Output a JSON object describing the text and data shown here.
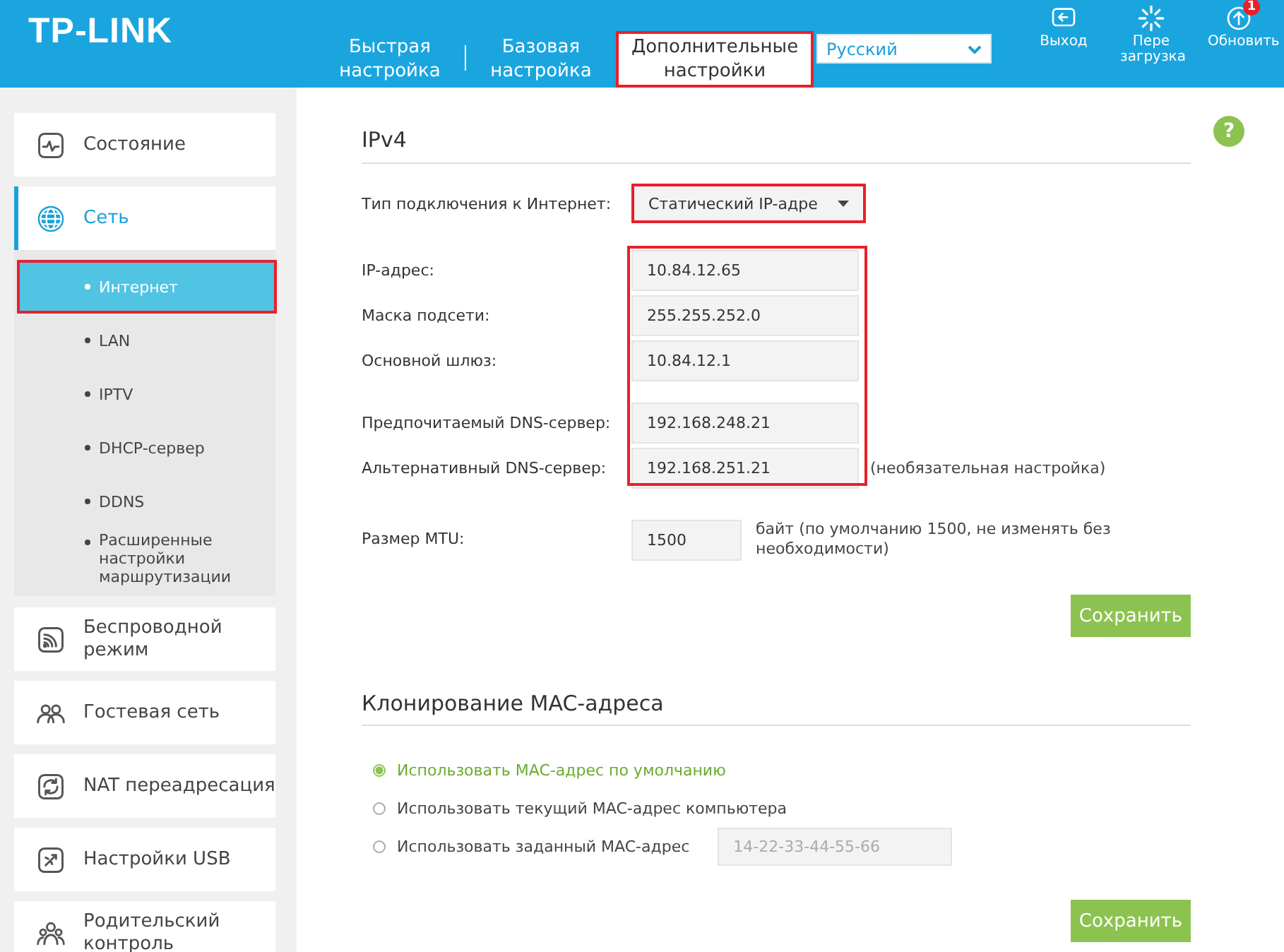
{
  "header": {
    "logo": "TP-LINK",
    "nav_tabs": [
      {
        "label": "Быстрая настройка",
        "selected": false,
        "highlighted": false
      },
      {
        "label": "Базовая настройка",
        "selected": false,
        "highlighted": false
      },
      {
        "label": "Дополнительные настройки",
        "selected": true,
        "highlighted": true
      }
    ],
    "language": {
      "value": "Русский"
    },
    "actions": [
      {
        "label": "Выход"
      },
      {
        "label": "Пере загрузка"
      },
      {
        "label": "Обновить",
        "badge": "1"
      }
    ]
  },
  "sidebar": {
    "items": [
      {
        "label": "Состояние",
        "selected": false
      },
      {
        "label": "Сеть",
        "selected": true,
        "expanded": true,
        "children": [
          {
            "label": "Интернет",
            "selected": true,
            "highlighted": true
          },
          {
            "label": "LAN",
            "selected": false,
            "highlighted": false
          },
          {
            "label": "IPTV",
            "selected": false,
            "highlighted": false
          },
          {
            "label": "DHCP-сервер",
            "selected": false,
            "highlighted": false
          },
          {
            "label": "DDNS",
            "selected": false,
            "highlighted": false
          },
          {
            "label": "Расширенные настройки маршрутизации",
            "selected": false,
            "highlighted": false
          }
        ]
      },
      {
        "label": "Беспроводной режим",
        "selected": false
      },
      {
        "label": "Гостевая сеть",
        "selected": false
      },
      {
        "label": "NAT переадресация",
        "selected": false
      },
      {
        "label": "Настройки USB",
        "selected": false
      },
      {
        "label": "Родительский контроль",
        "selected": false
      }
    ]
  },
  "help_button": {
    "label": "?"
  },
  "ipv4": {
    "title": "IPv4",
    "connection_type": {
      "label": "Тип подключения к Интернет:",
      "value": "Статический IP-адре",
      "highlighted": true
    },
    "fields_highlighted": true,
    "address_fields": [
      {
        "label": "IP-адрес:",
        "value": "10.84.12.65"
      },
      {
        "label": "Маска подсети:",
        "value": "255.255.252.0"
      },
      {
        "label": "Основной шлюз:",
        "value": "10.84.12.1"
      }
    ],
    "dns_fields": [
      {
        "label": "Предпочитаемый DNS-сервер:",
        "value": "192.168.248.21"
      },
      {
        "label": "Альтернативный DNS-сервер:",
        "value": "192.168.251.21",
        "note": "(необязательная настройка)"
      }
    ],
    "mtu": {
      "label": "Размер MTU:",
      "value": "1500",
      "note": "байт (по умолчанию 1500, не изменять без необходимости)"
    },
    "save_button": "Сохранить"
  },
  "mac_clone": {
    "title": "Клонирование MAC-адреса",
    "options": [
      {
        "label": "Использовать MAC-адрес по умолчанию",
        "selected": true
      },
      {
        "label": "Использовать текущий MAC-адрес компьютера",
        "selected": false
      },
      {
        "label": "Использовать заданный MAC-адрес",
        "selected": false,
        "placeholder": "14-22-33-44-55-66"
      }
    ],
    "save_button": "Сохранить"
  }
}
